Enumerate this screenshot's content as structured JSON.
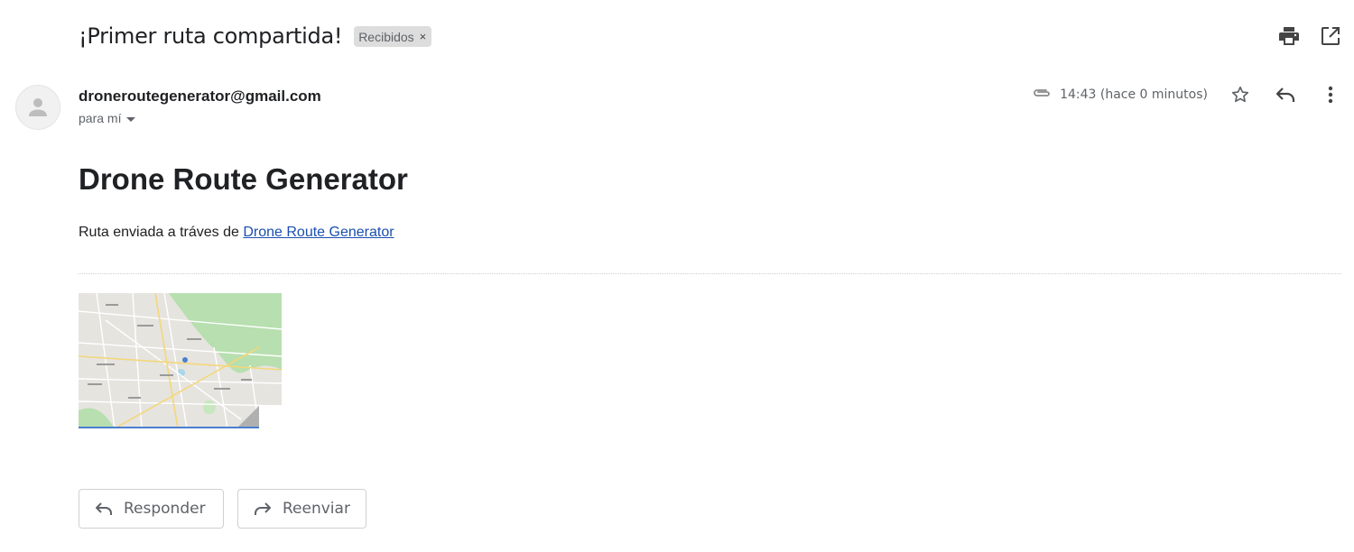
{
  "email": {
    "subject": "¡Primer ruta compartida!",
    "label": "Recibidos",
    "label_remove": "×",
    "sender": "droneroutegenerator@gmail.com",
    "to": "para mí",
    "time": "14:43 (hace 0 minutos)"
  },
  "body": {
    "heading": "Drone Route Generator",
    "text_prefix": "Ruta enviada a tráves de ",
    "link_text": "Drone Route Generator"
  },
  "actions": {
    "reply_label": "Responder",
    "forward_label": "Reenviar"
  },
  "icons": {
    "top": [
      "print-icon",
      "open-in-new-window-icon"
    ],
    "header": [
      "attachment-icon",
      "star-icon",
      "reply-icon",
      "more-vert-icon"
    ]
  },
  "colors": {
    "link": "#1a4fb0",
    "secondary_text": "#5f6368",
    "chip_bg": "#dddddd",
    "map_park": "#a8d8a0"
  }
}
